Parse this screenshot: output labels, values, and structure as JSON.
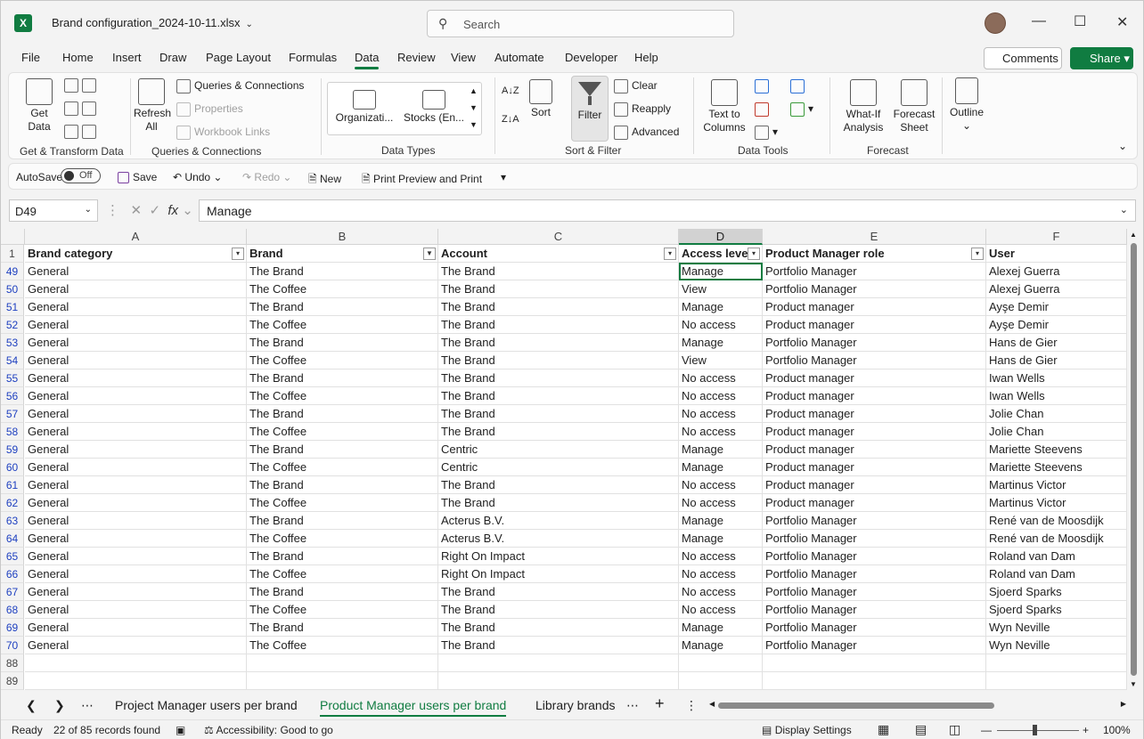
{
  "title": {
    "app_icon": "X",
    "filename": "Brand configuration_2024-10-11.xlsx",
    "search_placeholder": "Search"
  },
  "menu": [
    "File",
    "Home",
    "Insert",
    "Draw",
    "Page Layout",
    "Formulas",
    "Data",
    "Review",
    "View",
    "Automate",
    "Developer",
    "Help"
  ],
  "menu_active": "Data",
  "comments_label": "Comments",
  "share_label": "Share",
  "ribbon": {
    "get_data": "Get\nData",
    "refresh_all": "Refresh\nAll",
    "queries_connections": "Queries & Connections",
    "properties": "Properties",
    "workbook_links": "Workbook Links",
    "dt_org": "Organizati...",
    "dt_stocks": "Stocks (En...",
    "sort": "Sort",
    "filter": "Filter",
    "clear": "Clear",
    "reapply": "Reapply",
    "advanced": "Advanced",
    "text_to_columns": "Text to\nColumns",
    "what_if": "What-If\nAnalysis",
    "forecast_sheet": "Forecast\nSheet",
    "outline": "Outline",
    "groups": [
      "Get & Transform Data",
      "Queries & Connections",
      "Data Types",
      "Sort & Filter",
      "Data Tools",
      "Forecast"
    ]
  },
  "qat": {
    "autosave": "AutoSave",
    "autosave_state": "Off",
    "save": "Save",
    "undo": "Undo",
    "redo": "Redo",
    "new": "New",
    "print_preview": "Print Preview and Print"
  },
  "formula_bar": {
    "name_box": "D49",
    "fx": "fx",
    "value": "Manage"
  },
  "grid": {
    "column_letters": [
      "A",
      "B",
      "C",
      "D",
      "E",
      "F"
    ],
    "headers": [
      "Brand category",
      "Brand",
      "Account",
      "Access level",
      "Product Manager role",
      "User"
    ],
    "rows": [
      {
        "n": "49",
        "c": [
          "General",
          "The Brand",
          "The Brand",
          "Manage",
          "Portfolio Manager",
          "Alexej Guerra"
        ]
      },
      {
        "n": "50",
        "c": [
          "General",
          "The Coffee",
          "The Brand",
          "View",
          "Portfolio Manager",
          "Alexej Guerra"
        ]
      },
      {
        "n": "51",
        "c": [
          "General",
          "The Brand",
          "The Brand",
          "Manage",
          "Product manager",
          "Ayşe Demir"
        ]
      },
      {
        "n": "52",
        "c": [
          "General",
          "The Coffee",
          "The Brand",
          "No access",
          "Product manager",
          "Ayşe Demir"
        ]
      },
      {
        "n": "53",
        "c": [
          "General",
          "The Brand",
          "The Brand",
          "Manage",
          "Portfolio Manager",
          "Hans de Gier"
        ]
      },
      {
        "n": "54",
        "c": [
          "General",
          "The Coffee",
          "The Brand",
          "View",
          "Portfolio Manager",
          "Hans de Gier"
        ]
      },
      {
        "n": "55",
        "c": [
          "General",
          "The Brand",
          "The Brand",
          "No access",
          "Product manager",
          "Iwan Wells"
        ]
      },
      {
        "n": "56",
        "c": [
          "General",
          "The Coffee",
          "The Brand",
          "No access",
          "Product manager",
          "Iwan Wells"
        ]
      },
      {
        "n": "57",
        "c": [
          "General",
          "The Brand",
          "The Brand",
          "No access",
          "Product manager",
          "Jolie Chan"
        ]
      },
      {
        "n": "58",
        "c": [
          "General",
          "The Coffee",
          "The Brand",
          "No access",
          "Product manager",
          "Jolie Chan"
        ]
      },
      {
        "n": "59",
        "c": [
          "General",
          "The Brand",
          "Centric",
          "Manage",
          "Product manager",
          "Mariette Steevens"
        ]
      },
      {
        "n": "60",
        "c": [
          "General",
          "The Coffee",
          "Centric",
          "Manage",
          "Product manager",
          "Mariette Steevens"
        ]
      },
      {
        "n": "61",
        "c": [
          "General",
          "The Brand",
          "The Brand",
          "No access",
          "Product manager",
          "Martinus Victor"
        ]
      },
      {
        "n": "62",
        "c": [
          "General",
          "The Coffee",
          "The Brand",
          "No access",
          "Product manager",
          "Martinus Victor"
        ]
      },
      {
        "n": "63",
        "c": [
          "General",
          "The Brand",
          "Acterus B.V.",
          "Manage",
          "Portfolio Manager",
          "René van de Moosdijk"
        ]
      },
      {
        "n": "64",
        "c": [
          "General",
          "The Coffee",
          "Acterus B.V.",
          "Manage",
          "Portfolio Manager",
          "René van de Moosdijk"
        ]
      },
      {
        "n": "65",
        "c": [
          "General",
          "The Brand",
          "Right On Impact",
          "No access",
          "Portfolio Manager",
          "Roland van Dam"
        ]
      },
      {
        "n": "66",
        "c": [
          "General",
          "The Coffee",
          "Right On Impact",
          "No access",
          "Portfolio Manager",
          "Roland van Dam"
        ]
      },
      {
        "n": "67",
        "c": [
          "General",
          "The Brand",
          "The Brand",
          "No access",
          "Portfolio Manager",
          "Sjoerd Sparks"
        ]
      },
      {
        "n": "68",
        "c": [
          "General",
          "The Coffee",
          "The Brand",
          "No access",
          "Portfolio Manager",
          "Sjoerd Sparks"
        ]
      },
      {
        "n": "69",
        "c": [
          "General",
          "The Brand",
          "The Brand",
          "Manage",
          "Portfolio Manager",
          "Wyn Neville"
        ]
      },
      {
        "n": "70",
        "c": [
          "General",
          "The Coffee",
          "The Brand",
          "Manage",
          "Portfolio Manager",
          "Wyn Neville"
        ]
      }
    ],
    "empty_rows": [
      "88",
      "89"
    ]
  },
  "sheets": [
    "Project Manager users per brand",
    "Product Manager users per brand",
    "Library brands"
  ],
  "active_sheet": "Product Manager users per brand",
  "status": {
    "ready": "Ready",
    "records": "22 of 85 records found",
    "accessibility": "Accessibility: Good to go",
    "display_settings": "Display Settings",
    "zoom": "100%"
  },
  "colors": {
    "accent": "#107c41",
    "row_number_blue": "#1f41c0"
  }
}
